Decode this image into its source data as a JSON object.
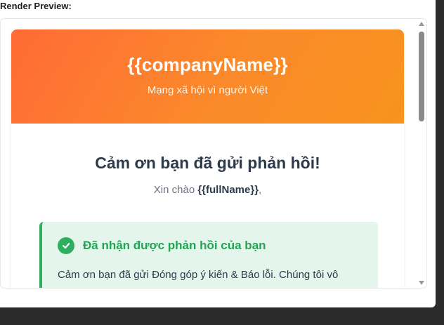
{
  "panel": {
    "label": "Render Preview:"
  },
  "email": {
    "header": {
      "company_name": "{{companyName}}",
      "tagline": "Mạng xã hội vì người Việt"
    },
    "body": {
      "title": "Cảm ơn bạn đã gửi phản hồi!",
      "greeting_prefix": "Xin chào ",
      "greeting_name": "{{fullName}}",
      "greeting_suffix": ","
    },
    "success_box": {
      "title": "Đã nhận được phản hồi của bạn",
      "text": "Cảm ơn bạn đã gửi Đóng góp ý kiến & Báo lỗi. Chúng tôi vô"
    }
  },
  "colors": {
    "header_gradient_start": "#ff6b35",
    "header_gradient_end": "#f7931e",
    "success_green": "#2eaf5f",
    "success_bg": "#e4f5ec",
    "title_text": "#2d3a4a"
  },
  "icons": {
    "success": "check-circle-icon",
    "scroll_up": "arrow-up-icon",
    "scroll_down": "arrow-down-icon"
  }
}
